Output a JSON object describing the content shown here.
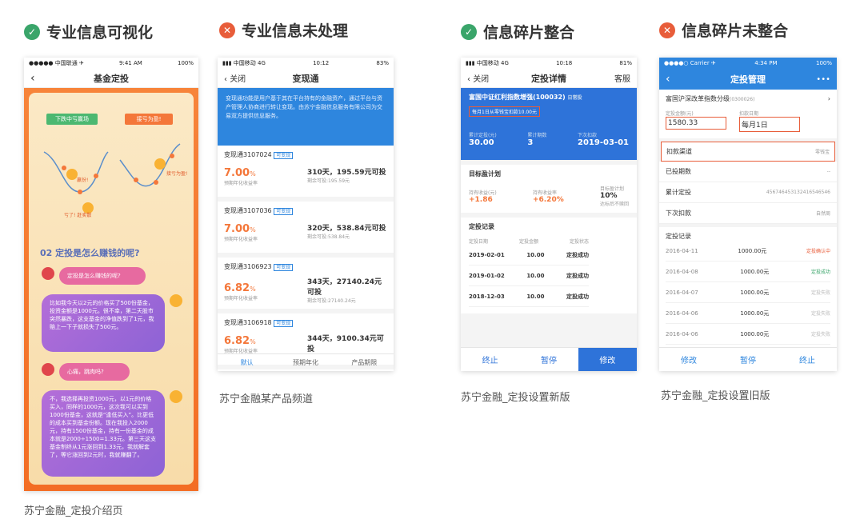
{
  "headings": [
    {
      "icon": "✓",
      "text": "专业信息可视化"
    },
    {
      "icon": "✕",
      "text": "专业信息未处理"
    },
    {
      "icon": "✓",
      "text": "信息碎片整合"
    },
    {
      "icon": "✕",
      "text": "信息碎片未整合"
    }
  ],
  "captions": [
    "苏宁金融_定投介绍页",
    "苏宁金融某产品频道",
    "苏宁金融_定投设置新版",
    "苏宁金融_定投设置旧版"
  ],
  "p1": {
    "status": {
      "left": "●●●●● 中国联通 ✈",
      "time": "9:41 AM",
      "right": "100%"
    },
    "title": "基金定投",
    "tag_left": "下跌中亏赢场",
    "tag_right": "接亏为盈!",
    "chart_note1": "赢份!",
    "chart_note2": "亏了! 赶卖散",
    "chart_note3": "接亏为盈!",
    "section": "02 定投是怎么赚钱的呢?",
    "q1": "定投是怎么赚钱的呢?",
    "a1": "比如我今天以2元的价格买了500份基金，投资金额是1000元。很不幸，第二天股市突然暴跌，这支基金的净值跌到了1元，我赔上一下子就损失了500元。",
    "q2": "心痛，跳肉吗?",
    "a2": "不，我选择再投资1000元，以1元的价格买入，同样的1000元，这次我可以买到1000份基金，这就是“逢低买入”。比更低的成本买到基金份额。现在我投入2000元，持有1500份基金，持有一份基金的成本就是2000÷1500=1.33元。第三天这支基金制终从1元涨回到1.33元，我就解套了，等它涨回到2元时，我就赚翻了。"
  },
  "p2": {
    "status": {
      "left": "▮▮▮ 中国移动 4G",
      "time": "10:12",
      "right": "83%"
    },
    "back": "关闭",
    "title": "变现通",
    "banner": "变现通功能是用户基于其在平台持有的金融资产，通过平台与资产管理人协商进行转让变现。由苏宁金融信息服务有限公司为交易双方提供信息服务。",
    "items": [
      {
        "name": "变现通3107024",
        "tag": "可变现",
        "rate": "7.00",
        "rate_unit": "%",
        "rate_label": "预期年化收益率",
        "days": "310天，195.59元可投",
        "remain": "剩余可投:195.59元"
      },
      {
        "name": "变现通3107036",
        "tag": "可变现",
        "rate": "7.00",
        "rate_unit": "%",
        "rate_label": "预期年化收益率",
        "days": "320天，538.84元可投",
        "remain": "剩余可投:538.84元"
      },
      {
        "name": "变现通3106923",
        "tag": "可变现",
        "rate": "6.82",
        "rate_unit": "%",
        "rate_label": "预期年化收益率",
        "days": "343天，27140.24元可投",
        "remain": "剩余可投:27140.24元"
      },
      {
        "name": "变现通3106918",
        "tag": "可变现",
        "rate": "6.82",
        "rate_unit": "%",
        "rate_label": "预期年化收益率",
        "days": "344天，9100.34元可投",
        "remain": ""
      }
    ],
    "tabs": [
      "默认",
      "预期年化",
      "产品期限"
    ]
  },
  "p3": {
    "status": {
      "left": "▮▮▮ 中国移动 4G",
      "time": "10:18",
      "right": "81%"
    },
    "back": "关闭",
    "title": "定投详情",
    "right": "客服",
    "fund": "富国中证红利指数增强(100032)",
    "fund_tag": "日常投",
    "plan": "每月1日从零钱宝扣款10.00元",
    "stats": [
      {
        "label": "累计定投(元)",
        "value": "30.00"
      },
      {
        "label": "累计期数",
        "value": "3"
      },
      {
        "label": "下次扣款",
        "value": "2019-03-01"
      }
    ],
    "goal_title": "目标盈计划",
    "goal": [
      {
        "label": "持有收益(元)",
        "value": "+1.86",
        "cls": "o"
      },
      {
        "label": "持有收益率",
        "value": "+6.20%",
        "cls": "o"
      },
      {
        "label": "目标盈计划",
        "value": "10%",
        "cls": "d",
        "sub": "达标后不赎回"
      }
    ],
    "rec_title": "定投记录",
    "rec_head": [
      "定投日期",
      "定投金额",
      "定投状态"
    ],
    "records": [
      [
        "2019-02-01",
        "10.00",
        "定投成功"
      ],
      [
        "2019-01-02",
        "10.00",
        "定投成功"
      ],
      [
        "2018-12-03",
        "10.00",
        "定投成功"
      ]
    ],
    "tabs": [
      "终止",
      "暂停",
      "修改"
    ]
  },
  "p4": {
    "status": {
      "left": "●●●●○ Carrier ✈",
      "time": "4:34 PM",
      "right": "100%"
    },
    "title": "定投管理",
    "fund": "富国沪深改革指数分级",
    "fund_code": "(0300026)",
    "amount_label": "定投金额(元)",
    "amount": "1580.33",
    "date_label": "扣款日期",
    "date": "每月1日",
    "channel_label": "扣款渠道",
    "channel": "零钱宝",
    "rows": [
      {
        "label": "已投期数",
        "value": "--"
      },
      {
        "label": "累计定投",
        "value": "456746453132416546546"
      },
      {
        "label": "下次扣款",
        "value": "自然周"
      }
    ],
    "rec_title": "定投记录",
    "records": [
      [
        "2016-04-11",
        "1000.00元",
        "定投确认中",
        "#e85d3a"
      ],
      [
        "2016-04-08",
        "1000.00元",
        "定投成功",
        "#3aa56a"
      ],
      [
        "2016-04-07",
        "1000.00元",
        "定投失败",
        "#bbb"
      ],
      [
        "2016-04-06",
        "1000.00元",
        "定投失败",
        "#bbb"
      ],
      [
        "2016-04-06",
        "1000.00元",
        "定投失败",
        "#bbb"
      ]
    ],
    "tabs": [
      "修改",
      "暂停",
      "终止"
    ]
  }
}
